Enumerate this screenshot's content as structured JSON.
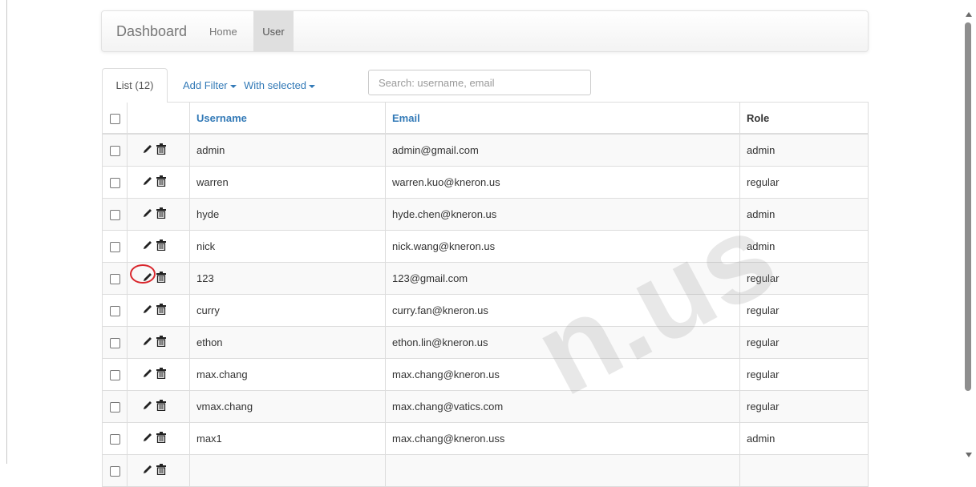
{
  "navbar": {
    "brand": "Dashboard",
    "links": [
      {
        "label": "Home"
      },
      {
        "label": "User",
        "active": true
      }
    ]
  },
  "tabs": {
    "list_label": "List (12)",
    "add_filter": "Add Filter",
    "with_selected": "With selected"
  },
  "search": {
    "placeholder": "Search: username, email",
    "value": ""
  },
  "table": {
    "columns": [
      {
        "label": ""
      },
      {
        "label": ""
      },
      {
        "label": "Username"
      },
      {
        "label": "Email"
      },
      {
        "label": "Role"
      }
    ],
    "rows": [
      {
        "username": "admin",
        "email": "admin@gmail.com",
        "role": "admin"
      },
      {
        "username": "warren",
        "email": "warren.kuo@kneron.us",
        "role": "regular"
      },
      {
        "username": "hyde",
        "email": "hyde.chen@kneron.us",
        "role": "admin"
      },
      {
        "username": "nick",
        "email": "nick.wang@kneron.us",
        "role": "admin"
      },
      {
        "username": "123",
        "email": "123@gmail.com",
        "role": "regular",
        "edit_highlighted": true
      },
      {
        "username": "curry",
        "email": "curry.fan@kneron.us",
        "role": "regular"
      },
      {
        "username": "ethon",
        "email": "ethon.lin@kneron.us",
        "role": "regular"
      },
      {
        "username": "max.chang",
        "email": "max.chang@kneron.us",
        "role": "regular"
      },
      {
        "username": "vmax.chang",
        "email": "max.chang@vatics.com",
        "role": "regular"
      },
      {
        "username": "max1",
        "email": "max.chang@kneron.uss",
        "role": "admin"
      },
      {
        "username": "",
        "email": "",
        "role": ""
      }
    ]
  },
  "icons": {
    "edit": "pencil-icon",
    "delete": "trash-icon",
    "row_select": "checkbox"
  },
  "watermark": "n.us",
  "colors": {
    "link": "#337ab7",
    "highlight": "#d9262c",
    "nav_active_bg": "#dfdfdf"
  }
}
